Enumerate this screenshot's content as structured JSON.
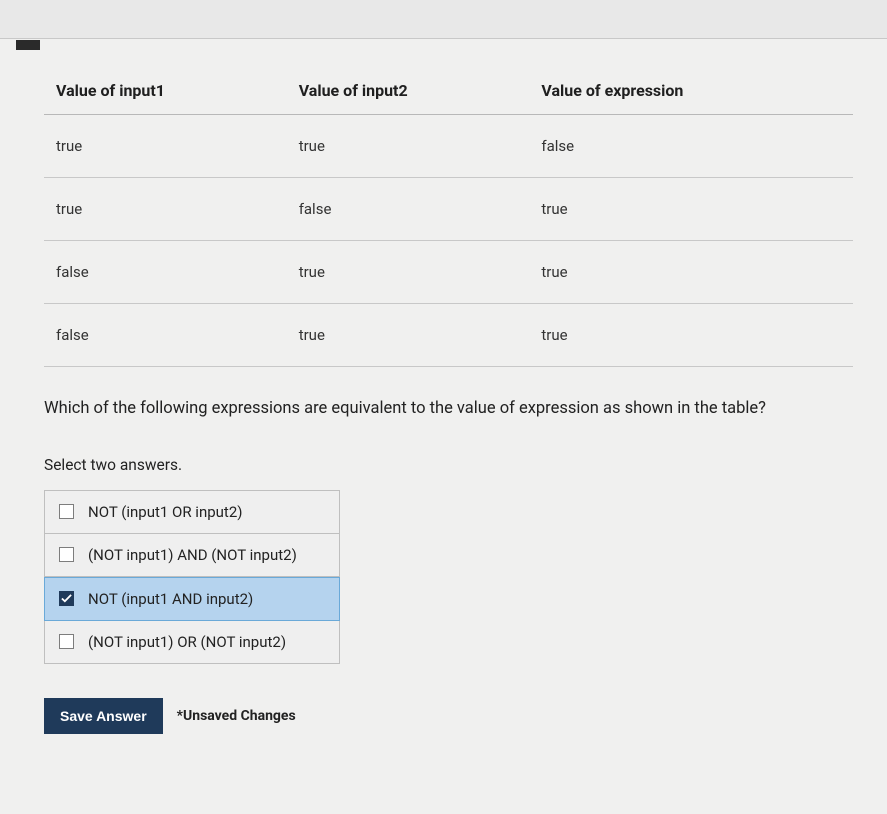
{
  "table": {
    "headers": [
      "Value of input1",
      "Value of input2",
      "Value of expression"
    ],
    "rows": [
      {
        "c0": "true",
        "c1": "true",
        "c2": "false"
      },
      {
        "c0": "true",
        "c1": "false",
        "c2": "true"
      },
      {
        "c0": "false",
        "c1": "true",
        "c2": "true"
      },
      {
        "c0": "false",
        "c1": "true",
        "c2": "true"
      }
    ]
  },
  "question_text": "Which of the following expressions are equivalent to the value of expression as shown in the table?",
  "instruction_text": "Select two answers.",
  "options": [
    {
      "label": "NOT (input1 OR input2)",
      "checked": false
    },
    {
      "label": "(NOT input1) AND (NOT input2)",
      "checked": false
    },
    {
      "label": "NOT (input1 AND input2)",
      "checked": true
    },
    {
      "label": "(NOT input1) OR (NOT input2)",
      "checked": false
    }
  ],
  "footer": {
    "save_label": "Save Answer",
    "unsaved_label": "*Unsaved Changes"
  }
}
